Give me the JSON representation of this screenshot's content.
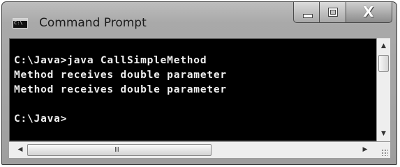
{
  "window": {
    "title": "Command Prompt",
    "app_icon_text": "C:\\"
  },
  "console": {
    "lines": [
      "C:\\Java>java CallSimpleMethod",
      "Method receives double parameter",
      "Method receives double parameter",
      "",
      "C:\\Java>"
    ]
  },
  "icons": {
    "app": "command-prompt-icon",
    "minimize": "minimize-icon",
    "maximize": "maximize-icon",
    "close": "close-icon",
    "scroll_up": "chevron-up-icon",
    "scroll_down": "chevron-down-icon",
    "scroll_left": "chevron-left-icon",
    "scroll_right": "chevron-right-icon"
  },
  "scrollbars": {
    "close_glyph": "X",
    "h_grip": "III"
  }
}
